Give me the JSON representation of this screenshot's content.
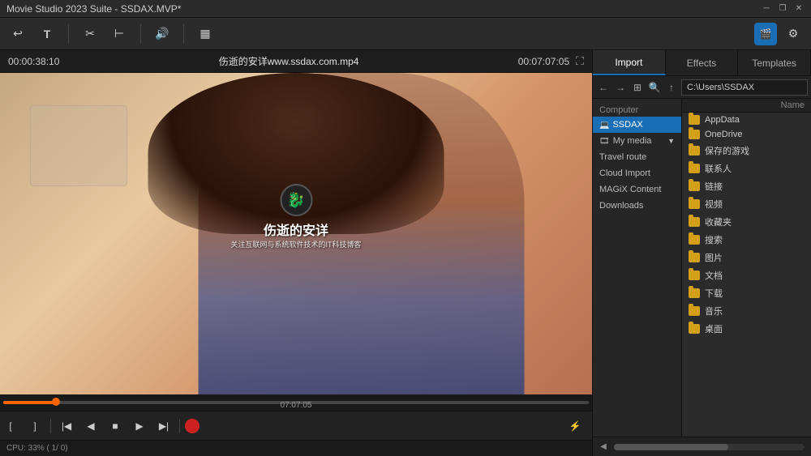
{
  "window": {
    "title": "Movie Studio 2023 Suite - SSDAX.MVP*"
  },
  "toolbar": {
    "buttons": [
      "undo-icon",
      "text-icon",
      "cut-icon",
      "trim-icon",
      "volume-icon",
      "storyboard-icon"
    ]
  },
  "video": {
    "timecode_left": "00:00:38:10",
    "filename": "伤逝的安详www.ssdax.com.mp4",
    "timecode_right": "00:07:07:05",
    "progress_time": "07:07:05",
    "watermark_title": "伤逝的安详",
    "watermark_subtitle": "关注互联网与系统软件技术的IT科技博客"
  },
  "tabs": {
    "import": "Import",
    "effects": "Effects",
    "templates": "Templates"
  },
  "browser": {
    "path": "C:\\Users\\SSDAX",
    "column_name": "Name"
  },
  "nav": {
    "computer_label": "Computer",
    "ssdax_label": "SSDAX",
    "my_media_label": "My media",
    "travel_route_label": "Travel route",
    "cloud_import_label": "Cloud Import",
    "magix_content_label": "MAGiX Content",
    "downloads_label": "Downloads"
  },
  "files": [
    {
      "name": "AppData"
    },
    {
      "name": "OneDrive"
    },
    {
      "name": "保存的游戏"
    },
    {
      "name": "联系人"
    },
    {
      "name": "链接"
    },
    {
      "name": "视频"
    },
    {
      "name": "收藏夹"
    },
    {
      "name": "搜索"
    },
    {
      "name": "图片"
    },
    {
      "name": "文档"
    },
    {
      "name": "下载"
    },
    {
      "name": "音乐"
    },
    {
      "name": "桌面"
    }
  ],
  "status": {
    "cpu": "CPU: 33% ( 1/ 0)"
  },
  "transport": {
    "mark_in": "[",
    "mark_out": "]",
    "go_start": "|<",
    "prev_frame": "◀",
    "stop": "■",
    "next_frame": "▶",
    "go_end": ">|",
    "record": ""
  }
}
